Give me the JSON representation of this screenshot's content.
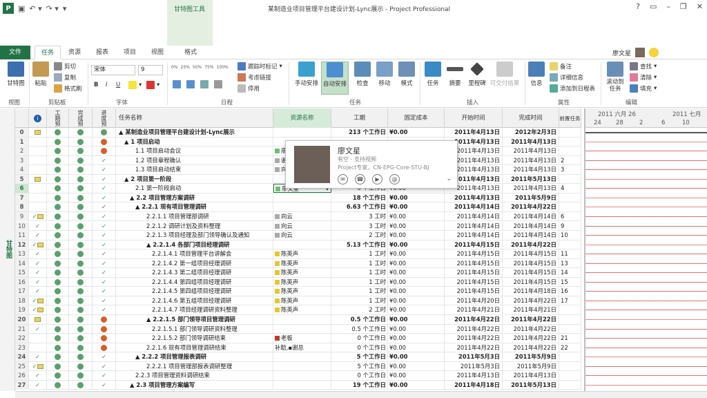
{
  "window": {
    "title": "某制造业项目管理平台建设计划-Lync展示 - Project Professional",
    "tool_context": "甘特图工具",
    "controls": [
      "?",
      "▭",
      "–",
      "❐",
      "✕"
    ]
  },
  "tabs": [
    "文件",
    "任务",
    "资源",
    "报表",
    "项目",
    "视图",
    "格式"
  ],
  "active_tab": "任务",
  "user": {
    "name": "廖文星"
  },
  "ribbon": {
    "view": {
      "gantt": "甘特图",
      "group": "视图"
    },
    "clipboard": {
      "paste": "粘贴",
      "cut": "剪切",
      "copy": "复制",
      "format_painter": "格式刷",
      "group": "剪贴板"
    },
    "font": {
      "font_name": "宋体",
      "font_size": "9",
      "bold": "B",
      "italic": "I",
      "underline": "U",
      "group": "字体"
    },
    "schedule": {
      "pcts": [
        "0%",
        "25%",
        "50%",
        "75%",
        "100%"
      ],
      "track": "跟踪时标记",
      "respect": "考虑链接",
      "inactive": "停用",
      "group": "日程"
    },
    "tasks": {
      "manual": "手动安排",
      "auto": "自动安排",
      "inspect": "检查",
      "move": "移动",
      "mode": "模式",
      "group": "任务"
    },
    "insert": {
      "task": "任务",
      "summary": "摘要",
      "milestone": "里程碑",
      "deliverable": "可交付结果",
      "group": "插入"
    },
    "properties": {
      "info": "信息",
      "notes": "备注",
      "details": "详细信息",
      "add_timeline": "添加到日程表",
      "group": "属性"
    },
    "editing": {
      "scroll": "滚动到任务",
      "find": "查找",
      "clear": "清除",
      "fill": "填充",
      "group": "编辑"
    }
  },
  "view_strip_label": "甘特图",
  "columns": {
    "planned": "工期预",
    "done": "完成预",
    "progress": "进度预",
    "name": "任务名称",
    "resource": "资源名称",
    "duration": "工期",
    "fixed_cost": "固定成本",
    "start": "开始时间",
    "finish": "完成时间",
    "pred": "前置任务"
  },
  "timescale": {
    "top": [
      "2011 六月 26",
      "2011 七月"
    ],
    "bottom": [
      "24",
      "28",
      "2",
      "6",
      "10"
    ]
  },
  "rows": [
    {
      "id": "0",
      "info": "note",
      "p": "g",
      "d": "g",
      "g": "g",
      "name": "▲ 某制造业项目管理平台建设计划-Lync展示",
      "indent": 0,
      "sum": true,
      "res": "",
      "resc": "",
      "dur": "213 个工作日",
      "cost": "¥0.00",
      "start": "2011年4月13日",
      "finish": "2012年2月3日",
      "pred": ""
    },
    {
      "id": "1",
      "info": "",
      "p": "g",
      "d": "g",
      "g": "o",
      "name": "▲ 1 项目启动",
      "indent": 1,
      "sum": true,
      "res": "",
      "resc": "",
      "dur": "",
      "cost": "",
      "start": "2011年4月13日",
      "finish": "2011年4月13日",
      "pred": ""
    },
    {
      "id": "2",
      "info": "",
      "p": "g",
      "d": "g",
      "g": "o",
      "name": "1.1 项目启动会议",
      "indent": 3,
      "sum": false,
      "res": "廖",
      "resc": "#6cbf6c",
      "dur": "",
      "cost": "",
      "start": "2011年4月13日",
      "finish": "2011年4月13日",
      "pred": ""
    },
    {
      "id": "3",
      "info": "",
      "p": "g",
      "d": "g",
      "g": "c",
      "name": "1.2 项目章程确认",
      "indent": 3,
      "sum": false,
      "res": "谢",
      "resc": "#aaa",
      "dur": "",
      "cost": "",
      "start": "2011年4月13日",
      "finish": "2011年4月13日",
      "pred": "2"
    },
    {
      "id": "4",
      "info": "",
      "p": "g",
      "d": "g",
      "g": "c",
      "name": "1.3 项目启动结束",
      "indent": 3,
      "sum": false,
      "res": "向",
      "resc": "#aaa",
      "dur": "",
      "cost": "",
      "start": "2011年4月13日",
      "finish": "2011年4月13日",
      "pred": "3"
    },
    {
      "id": "5",
      "info": "note",
      "p": "g",
      "d": "g",
      "g": "c",
      "name": "▲ 2 项目第一阶段",
      "indent": 1,
      "sum": true,
      "res": "",
      "resc": "",
      "dur": "",
      "cost": "",
      "start": "2011年4月13日",
      "finish": "2011年5月13日",
      "pred": ""
    },
    {
      "id": "6",
      "info": "",
      "p": "g",
      "d": "g",
      "g": "c",
      "name": "2.1 第一阶段启动",
      "indent": 3,
      "sum": false,
      "res": "廖文星",
      "resc": "#6cbf6c",
      "dur": "0 个工作日",
      "cost": "¥0.00",
      "start": "2011年4月13日",
      "finish": "2011年4月13日",
      "pred": "4",
      "sel": true
    },
    {
      "id": "7",
      "info": "",
      "p": "g",
      "d": "g",
      "g": "c",
      "name": "▲ 2.2 项目管理方案调研",
      "indent": 2,
      "sum": true,
      "res": "",
      "resc": "",
      "dur": "18 个工作日",
      "cost": "¥0.00",
      "start": "2011年4月13日",
      "finish": "2011年5月9日",
      "pred": ""
    },
    {
      "id": "8",
      "info": "",
      "p": "g",
      "d": "g",
      "g": "c",
      "name": "▲ 2.2.1 现有项目管理调研",
      "indent": 3,
      "sum": true,
      "res": "",
      "resc": "",
      "dur": "6.63 个工作日",
      "cost": "¥0.00",
      "start": "2011年4月14日",
      "finish": "2011年4月22日",
      "pred": ""
    },
    {
      "id": "9",
      "info": "chknote",
      "p": "g",
      "d": "g",
      "g": "c",
      "name": "2.2.1.1 项目管理部调研",
      "indent": 5,
      "sum": false,
      "res": "向云",
      "resc": "#aaa",
      "dur": "3 工时",
      "cost": "¥0.00",
      "start": "2011年4月14日",
      "finish": "2011年4月14日",
      "pred": "6"
    },
    {
      "id": "10",
      "info": "chk",
      "p": "g",
      "d": "g",
      "g": "c",
      "name": "2.2.1.2 调研计划及资料整理",
      "indent": 5,
      "sum": false,
      "res": "向云",
      "resc": "#aaa",
      "dur": "3 工时",
      "cost": "¥0.00",
      "start": "2011年4月14日",
      "finish": "2011年4月14日",
      "pred": "9"
    },
    {
      "id": "11",
      "info": "chk",
      "p": "g",
      "d": "g",
      "g": "c",
      "name": "2.2.1.3 项目经理及部门领导确认及通知",
      "indent": 5,
      "sum": false,
      "res": "向云",
      "resc": "#aaa",
      "dur": "2 工时",
      "cost": "¥0.00",
      "start": "2011年4月14日",
      "finish": "2011年4月14日",
      "pred": "10"
    },
    {
      "id": "12",
      "info": "chknote",
      "p": "g",
      "d": "g",
      "g": "c",
      "name": "▲ 2.2.1.4 各部门项目经理调研",
      "indent": 5,
      "sum": true,
      "res": "",
      "resc": "",
      "dur": "5.13 个工作日",
      "cost": "¥0.00",
      "start": "2011年4月15日",
      "finish": "2011年4月22日",
      "pred": ""
    },
    {
      "id": "13",
      "info": "chk",
      "p": "g",
      "d": "g",
      "g": "c",
      "name": "2.2.1.4.1 项目管理平台讲解会",
      "indent": 6,
      "sum": false,
      "res": "陈英声",
      "resc": "#e5c82a",
      "dur": "1 工时",
      "cost": "¥0.00",
      "start": "2011年4月15日",
      "finish": "2011年4月15日",
      "pred": "11"
    },
    {
      "id": "14",
      "info": "chk",
      "p": "g",
      "d": "g",
      "g": "c",
      "name": "2.2.1.4.2 第一组项目经理调研",
      "indent": 6,
      "sum": false,
      "res": "陈英声",
      "resc": "#e5c82a",
      "dur": "1 工时",
      "cost": "¥0.00",
      "start": "2011年4月15日",
      "finish": "2011年4月15日",
      "pred": "13"
    },
    {
      "id": "15",
      "info": "chk",
      "p": "g",
      "d": "g",
      "g": "c",
      "name": "2.2.1.4.3 第二组项目经理调研",
      "indent": 6,
      "sum": false,
      "res": "陈英声",
      "resc": "#e5c82a",
      "dur": "1 工时",
      "cost": "¥0.00",
      "start": "2011年4月15日",
      "finish": "2011年4月15日",
      "pred": "14"
    },
    {
      "id": "16",
      "info": "chk",
      "p": "g",
      "d": "g",
      "g": "c",
      "name": "2.2.1.4.4 第四组项目经理调研",
      "indent": 6,
      "sum": false,
      "res": "陈英声",
      "resc": "#e5c82a",
      "dur": "1 工时",
      "cost": "¥0.00",
      "start": "2011年4月15日",
      "finish": "2011年4月15日",
      "pred": "15"
    },
    {
      "id": "17",
      "info": "chk",
      "p": "g",
      "d": "g",
      "g": "c",
      "name": "2.2.1.4.5 第四组项目经理调研",
      "indent": 6,
      "sum": false,
      "res": "陈英声",
      "resc": "#e5c82a",
      "dur": "1 工时",
      "cost": "¥0.00",
      "start": "2011年4月15日",
      "finish": "2011年4月18日",
      "pred": "16"
    },
    {
      "id": "18",
      "info": "chknote",
      "p": "g",
      "d": "g",
      "g": "c",
      "name": "2.2.1.4.6 第五组项目经理调研",
      "indent": 6,
      "sum": false,
      "res": "陈英声",
      "resc": "#e5c82a",
      "dur": "1 工时",
      "cost": "¥0.00",
      "start": "2011年4月20日",
      "finish": "2011年4月22日",
      "pred": "17"
    },
    {
      "id": "19",
      "info": "chknote",
      "p": "g",
      "d": "g",
      "g": "c",
      "name": "2.2.1.4.7 项目经理调研资料整理",
      "indent": 6,
      "sum": false,
      "res": "陈英声",
      "resc": "#e5c82a",
      "dur": "2 工时",
      "cost": "¥0.00",
      "start": "2011年4月21日",
      "finish": "2011年4月21日",
      "pred": ""
    },
    {
      "id": "20",
      "info": "note",
      "p": "g",
      "d": "g",
      "g": "o",
      "name": "▲ 2.2.1.5 部门领导项目管理调研",
      "indent": 5,
      "sum": true,
      "res": "",
      "resc": "",
      "dur": "0.5 个工作日",
      "cost": "¥0.00",
      "start": "2011年4月22日",
      "finish": "2011年4月22日",
      "pred": ""
    },
    {
      "id": "21",
      "info": "chk",
      "p": "g",
      "d": "g",
      "g": "o",
      "name": "2.2.1.5.1 部门领导调研资料整理",
      "indent": 6,
      "sum": false,
      "res": "",
      "resc": "",
      "dur": "0.5 个工作日",
      "cost": "¥0.00",
      "start": "2011年4月22日",
      "finish": "2011年4月22日",
      "pred": ""
    },
    {
      "id": "22",
      "info": "",
      "p": "g",
      "d": "g",
      "g": "o",
      "name": "2.2.1.5.2 部门领导调研结束",
      "indent": 6,
      "sum": false,
      "res": "老板",
      "resc": "#c0392b",
      "dur": "0 个工作日",
      "cost": "¥0.00",
      "start": "2011年4月22日",
      "finish": "2011年4月22日",
      "pred": "21"
    },
    {
      "id": "23",
      "info": "",
      "p": "g",
      "d": "g",
      "g": "o",
      "name": "2.2.1.6 现有项目管理调研结束",
      "indent": 5,
      "sum": false,
      "res": "补助,▪谢总",
      "resc": "",
      "dur": "0 个工作日",
      "cost": "¥0.00",
      "start": "2011年4月22日",
      "finish": "2011年4月22日",
      "pred": "22"
    },
    {
      "id": "24",
      "info": "chk",
      "p": "g",
      "d": "g",
      "g": "c",
      "name": "▲ 2.2.2 项目管理报表调研",
      "indent": 3,
      "sum": true,
      "res": "",
      "resc": "",
      "dur": "5 个工作日",
      "cost": "¥0.00",
      "start": "2011年5月3日",
      "finish": "2011年5月9日",
      "pred": ""
    },
    {
      "id": "25",
      "info": "chknote",
      "p": "g",
      "d": "g",
      "g": "c",
      "name": "2.2.2.1 项目管理部报表调研整理",
      "indent": 5,
      "sum": false,
      "res": "",
      "resc": "",
      "dur": "5 个工作日",
      "cost": "¥0.00",
      "start": "2011年5月3日",
      "finish": "2011年5月9日",
      "pred": ""
    },
    {
      "id": "26",
      "info": "chk",
      "p": "g",
      "d": "g",
      "g": "c",
      "name": "2.2.3 项目管理资料调研结束",
      "indent": 3,
      "sum": false,
      "res": "",
      "resc": "",
      "dur": "0 个工作日",
      "cost": "¥0.00",
      "start": "2011年4月13日",
      "finish": "2011年4月13日",
      "pred": ""
    },
    {
      "id": "27",
      "info": "chk",
      "p": "g",
      "d": "g",
      "g": "c",
      "name": "▲ 2.3 项目管理方案编写",
      "indent": 2,
      "sum": true,
      "res": "",
      "resc": "",
      "dur": "19 个工作日",
      "cost": "¥0.00",
      "start": "2011年4月18日",
      "finish": "2011年5月13日",
      "pred": ""
    }
  ],
  "contact_card": {
    "name": "廖文星",
    "status": "有空 - 支持视频",
    "title": "Project专家，CN-EPG-Core-STU-BJ",
    "actions": [
      "message-icon",
      "phone-icon",
      "video-icon",
      "email-icon"
    ]
  }
}
